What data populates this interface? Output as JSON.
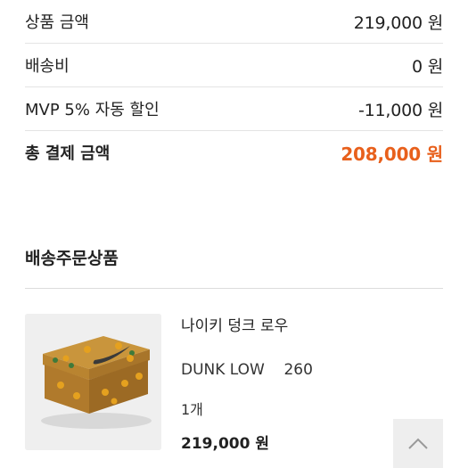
{
  "summary": {
    "rows": [
      {
        "label": "상품 금액",
        "value": "219,000 원"
      },
      {
        "label": "배송비",
        "value": "0 원"
      },
      {
        "label": "MVP 5% 자동 할인",
        "value": "-11,000 원"
      }
    ],
    "total": {
      "label": "총 결제 금액",
      "value": "208,000 원"
    }
  },
  "order": {
    "section_title": "배송주문상품",
    "product": {
      "name": "나이키 덩크 로우",
      "option": "DUNK LOW    260",
      "quantity": "1개",
      "price": "219,000 원",
      "image_icon": "shoe-box-image"
    }
  },
  "scroll_top": {
    "icon": "chevron-up-icon"
  },
  "colors": {
    "total_accent": "#e8601c",
    "divider": "#e4e4e4",
    "scroll_button_bg": "#eeeeee"
  }
}
